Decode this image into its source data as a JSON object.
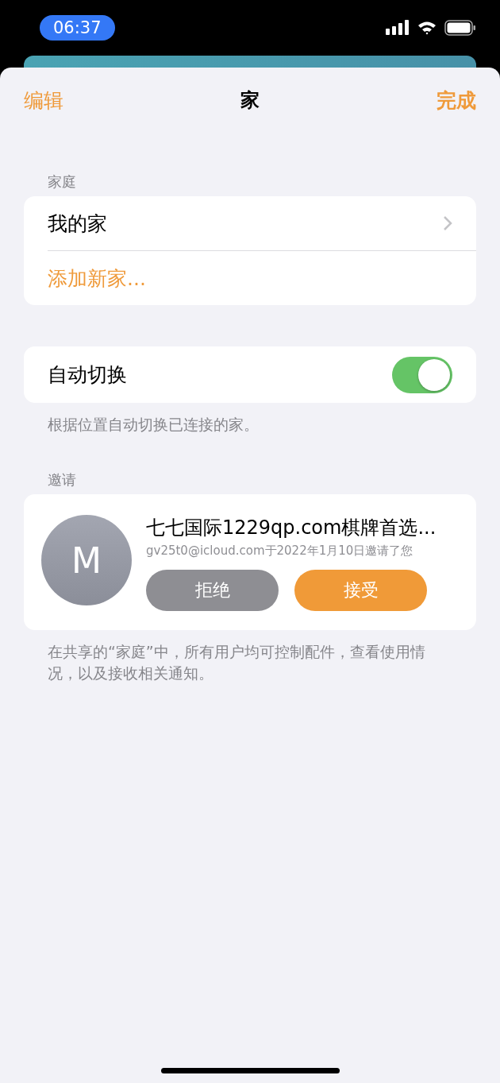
{
  "status_bar": {
    "time": "06:37"
  },
  "nav": {
    "left": "编辑",
    "title": "家",
    "right": "完成"
  },
  "homes_section": {
    "header": "家庭",
    "items": [
      {
        "label": "我的家",
        "kind": "home"
      },
      {
        "label": "添加新家...",
        "kind": "add"
      }
    ]
  },
  "auto_switch": {
    "label": "自动切换",
    "on": true,
    "footer": "根据位置自动切换已连接的家。"
  },
  "invitations": {
    "header": "邀请",
    "items": [
      {
        "avatar": "M",
        "title": "七七国际1229qp.com棋牌首选...",
        "subtitle": "gv25t0@icloud.com于2022年1月10日邀请了您",
        "buttons": [
          {
            "label": "拒绝",
            "kind": "decline"
          },
          {
            "label": "接受",
            "kind": "accept"
          }
        ]
      }
    ],
    "footer": "在共享的“家庭”中，所有用户均可控制配件，查看使用情况，以及接收相关通知。"
  }
}
